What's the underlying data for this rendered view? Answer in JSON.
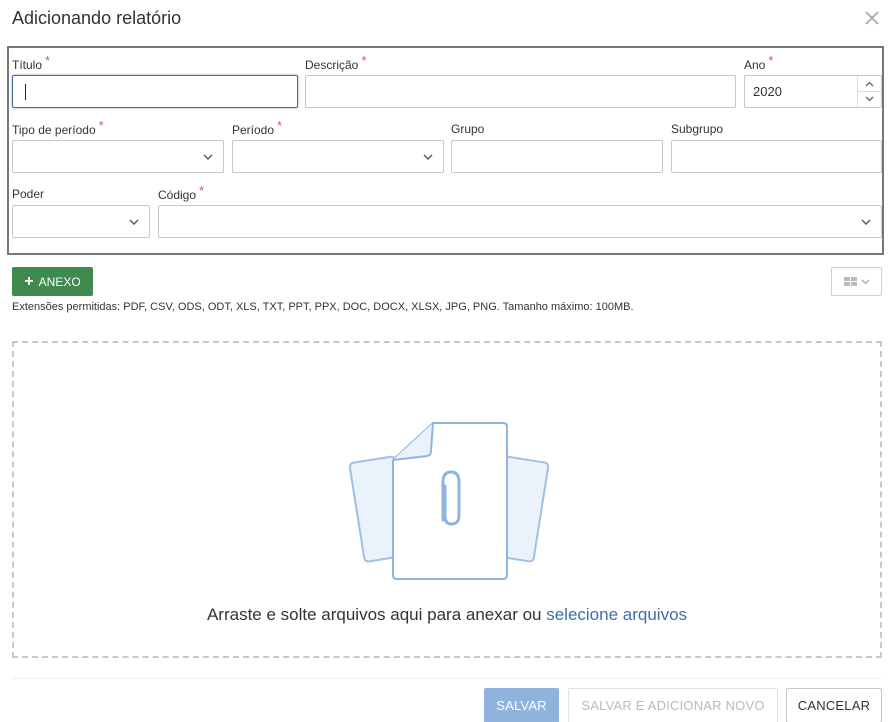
{
  "dialog": {
    "title": "Adicionando relatório",
    "close_icon": "close-icon"
  },
  "form": {
    "titulo": {
      "label": "Título",
      "required": "*",
      "value": ""
    },
    "descricao": {
      "label": "Descrição",
      "required": "*",
      "value": ""
    },
    "ano": {
      "label": "Ano",
      "required": "*",
      "value": "2020"
    },
    "tipo_periodo": {
      "label": "Tipo de período",
      "required": "*",
      "value": ""
    },
    "periodo": {
      "label": "Período",
      "required": "*",
      "value": ""
    },
    "grupo": {
      "label": "Grupo",
      "value": ""
    },
    "subgrupo": {
      "label": "Subgrupo",
      "value": ""
    },
    "poder": {
      "label": "Poder",
      "value": ""
    },
    "codigo": {
      "label": "Código",
      "required": "*",
      "value": ""
    }
  },
  "attachments": {
    "add_button_label": "ANEXO",
    "allowed_text": "Extensões permitidas: PDF, CSV, ODS, ODT, XLS, TXT, PPT, PPX, DOC, DOCX, XLSX, JPG, PNG. Tamanho máximo: 100MB.",
    "dropzone_text": "Arraste e solte arquivos aqui para anexar ou",
    "dropzone_link": "selecione arquivos"
  },
  "footer": {
    "save_label": "SALVAR",
    "save_new_label": "SALVAR E ADICIONAR NOVO",
    "cancel_label": "CANCELAR"
  },
  "colors": {
    "primary_green": "#3e8a4f",
    "link_blue": "#3d6fa8",
    "save_disabled_blue": "#8fb3dc",
    "required_red": "#d9534f"
  }
}
